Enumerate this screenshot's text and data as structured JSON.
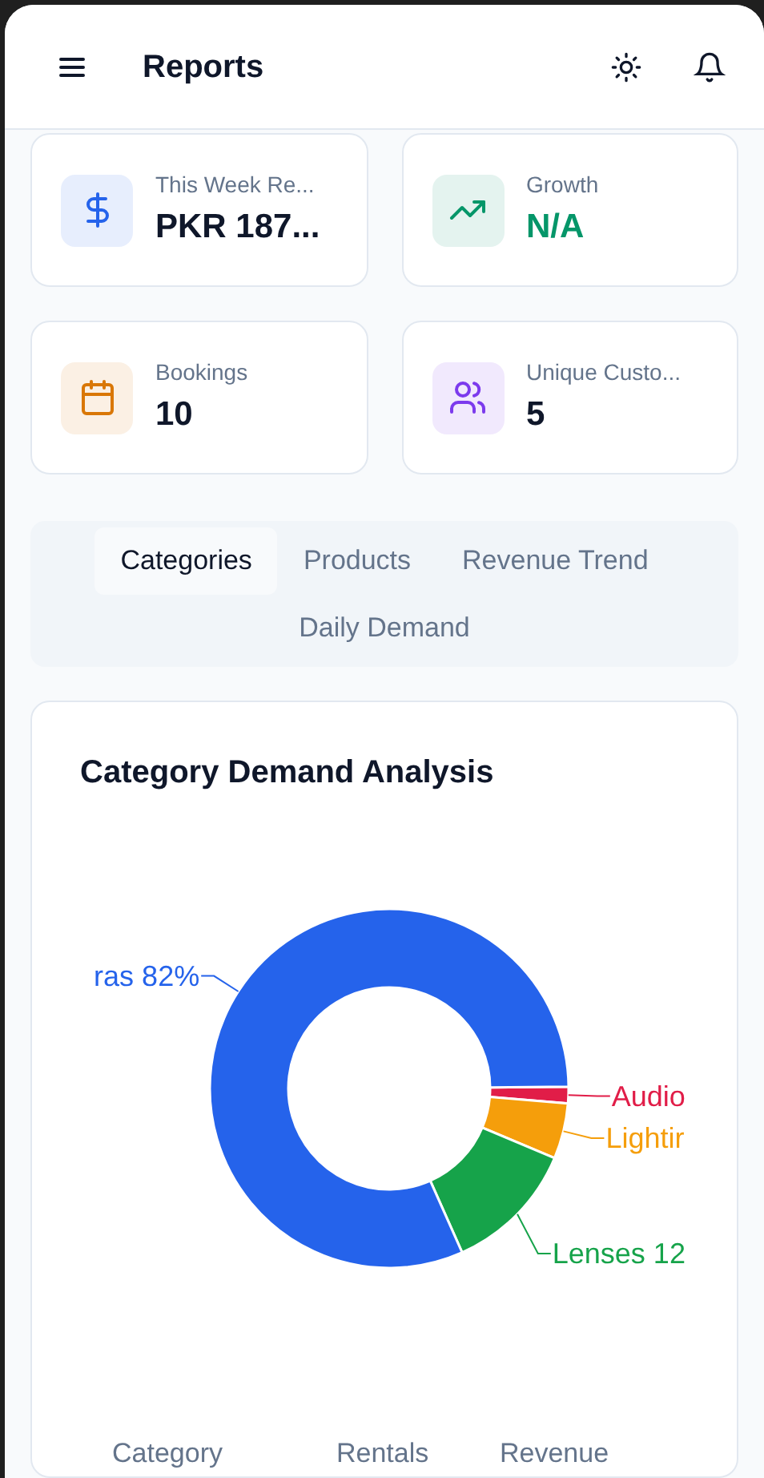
{
  "header": {
    "title": "Reports"
  },
  "stats": [
    {
      "label": "This Week Re...",
      "value": "PKR 187...",
      "kind": "revenue",
      "color": "#2563eb"
    },
    {
      "label": "Growth",
      "value": "N/A",
      "kind": "growth",
      "color": "#059669"
    },
    {
      "label": "Bookings",
      "value": "10",
      "kind": "bookings",
      "color": "#d97706"
    },
    {
      "label": "Unique Custo...",
      "value": "5",
      "kind": "customers",
      "color": "#7c3aed"
    }
  ],
  "tabs": [
    {
      "label": "Categories",
      "selected": true
    },
    {
      "label": "Products",
      "selected": false
    },
    {
      "label": "Revenue Trend",
      "selected": false
    },
    {
      "label": "Daily Demand",
      "selected": false
    }
  ],
  "chart_card": {
    "title": "Category Demand Analysis",
    "slices": [
      {
        "label": "Audio",
        "color": "#e11d48"
      },
      {
        "label": "Lightir",
        "color": "#f59e0b"
      },
      {
        "label": "Lenses 12",
        "color": "#16a34a"
      },
      {
        "label": "ras 82%",
        "color": "#2563eb"
      }
    ],
    "table": {
      "columns": [
        "Category",
        "Rentals",
        "Revenue"
      ]
    }
  }
}
